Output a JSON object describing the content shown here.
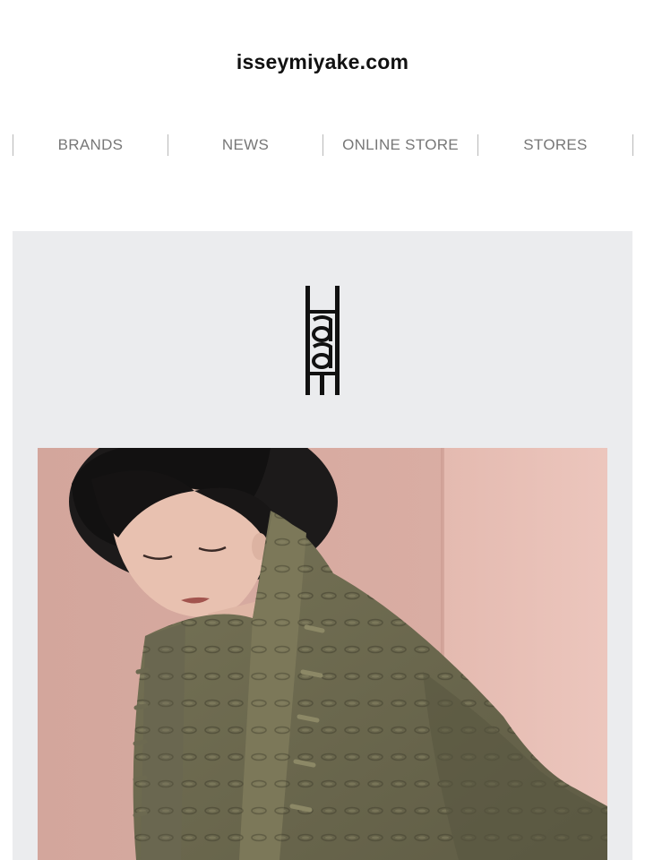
{
  "header": {
    "site_title": "isseymiyake.com"
  },
  "nav": {
    "items": [
      {
        "label": "BRANDS"
      },
      {
        "label": "NEWS"
      },
      {
        "label": "ONLINE STORE"
      },
      {
        "label": "STORES"
      }
    ]
  },
  "hero": {
    "brand_logo_icon": "haat-logo-icon",
    "photo_subject": "model-in-olive-jacket-photo",
    "colors": {
      "panel_background": "#ebecee",
      "photo_wall": "#d9aca2",
      "jacket": "#6f6c52"
    }
  }
}
